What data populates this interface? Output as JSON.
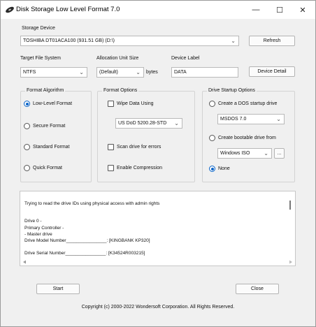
{
  "window": {
    "title": "Disk Storage Low Level Format 7.0",
    "minimize_glyph": "—",
    "maximize_glyph": "☐",
    "close_glyph": "✕"
  },
  "storage": {
    "label": "Storage Device",
    "selected": "TOSHIBA DT01ACA100 (931.51 GB) (D:\\)",
    "refresh_label": "Refresh"
  },
  "target": {
    "fs_label": "Target File System",
    "fs_value": "NTFS",
    "alloc_label": "Allocation Unit Size",
    "alloc_value": "(Default)",
    "alloc_unit": "bytes",
    "device_label_label": "Device Label",
    "device_label_value": "DATA",
    "device_detail_label": "Device Detail"
  },
  "format_algorithm": {
    "title": "Format Algorithm",
    "options": [
      "Low-Level Format",
      "Secure Format",
      "Standard Format",
      "Quick Format"
    ],
    "selected_index": 0
  },
  "format_options": {
    "title": "Format Options",
    "wipe_label": "Wipe Data Using",
    "wipe_method": "US DoD 5200.28-STD",
    "scan_label": "Scan drive for errors",
    "compression_label": "Enable Compression"
  },
  "startup": {
    "title": "Drive Startup Options",
    "dos_label": "Create a DOS startup drive",
    "dos_value": "MSDOS 7.0",
    "boot_label": "Create bootable drive from",
    "boot_value": "Windows ISO",
    "browse_label": "...",
    "none_label": "None"
  },
  "log": {
    "lines": [
      "Trying to read the drive IDs using physical access with admin rights",
      "Drive 0 -",
      "Primary Controller -",
      " - Master drive",
      "Drive Model Number________________: [KINGBANK KP320]",
      "Drive Serial Number________________: [K34524R003215]"
    ]
  },
  "actions": {
    "start_label": "Start",
    "close_label": "Close"
  },
  "footer": {
    "copyright": "Copyright (c) 2000-2022 Wondersoft Corporation. All Rights Reserved."
  },
  "colors": {
    "accent": "#0a64c8",
    "window_bg": "#f0f0f0"
  }
}
